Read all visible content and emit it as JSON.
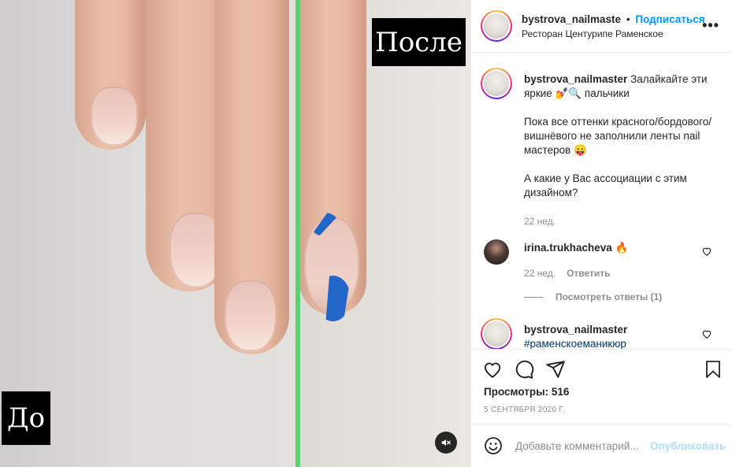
{
  "media": {
    "label_after": "После",
    "label_before": "До",
    "mute_icon": "speaker-muted-icon",
    "accent_divider": "#5ed06f"
  },
  "header": {
    "username": "bystrova_nailmaste",
    "separator": "•",
    "follow_label": "Подписаться",
    "location": "Ресторан Центурипе Раменское",
    "more_icon": "•••"
  },
  "caption": {
    "username": "bystrova_nailmaster",
    "line1": "Залайкайте эти яркие 💅🔍 пальчики",
    "line2": "Пока все оттенки красного/бордового/вишнёвого не заполнили ленты nail мастеров 😛",
    "line3": "А какие у Вас ассоциации с этим дизайном?",
    "time": "22 нед."
  },
  "comments": [
    {
      "username": "irina.trukhacheva",
      "text": "🔥",
      "time": "22 нед.",
      "reply_label": "Ответить",
      "view_replies": "Посмотреть ответы (1)"
    },
    {
      "username": "bystrova_nailmaster",
      "text": "#раменскоеманикюр"
    }
  ],
  "stats": {
    "views": "Просмотры: 516",
    "date": "5 СЕНТЯБРЯ 2020 Г."
  },
  "composer": {
    "placeholder": "Добавьте комментарий...",
    "publish_label": "Опубликовать",
    "link_color": "#0095f6"
  }
}
